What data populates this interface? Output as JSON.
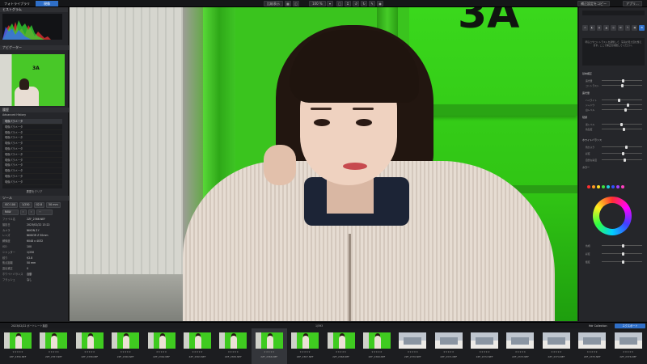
{
  "topbar": {
    "tabs": [
      "フォトライブラリ",
      "現像"
    ],
    "zoom": "100 %",
    "compare_label": "比較表示",
    "right_button": "補正設定をコピー",
    "export_label": "アプリ..."
  },
  "left": {
    "histogram_title": "ヒストグラム",
    "navigator_title": "ナビゲーター",
    "history_title": "履歴",
    "history_header": "Advanced History",
    "history_items": [
      "現像パラメータ",
      "現像パラメータ",
      "現像パラメータ",
      "現像パラメータ",
      "現像パラメータ",
      "現像パラメータ",
      "現像パラメータ",
      "現像パラメータ",
      "現像パラメータ",
      "現像パラメータ",
      "現像パラメータ",
      "現像パラメータ"
    ],
    "history_footer": "履歴をクリア",
    "tool_title": "ツール",
    "tool_buttons_1": [
      "ISO 100",
      "1/250",
      "f/2.8",
      "50 mm"
    ],
    "tool_buttons_2": [
      "RAW",
      "",
      "",
      ""
    ],
    "info": [
      {
        "k": "ファイル名",
        "v": "2ZF_2366.NEF"
      },
      {
        "k": "撮影日",
        "v": "2023/02/22 13:22"
      },
      {
        "k": "カメラ",
        "v": "NIKON Z f"
      },
      {
        "k": "レンズ",
        "v": "NIKKOR Z 50mm"
      },
      {
        "k": "解像度",
        "v": "6048 x 4032"
      },
      {
        "k": "ISO",
        "v": "100"
      },
      {
        "k": "シャッター",
        "v": "1/250"
      },
      {
        "k": "絞り",
        "v": "f/2.8"
      },
      {
        "k": "焦点距離",
        "v": "50 mm"
      },
      {
        "k": "露出補正",
        "v": "0"
      },
      {
        "k": "ホワイトバランス",
        "v": "自動"
      },
      {
        "k": "フラッシュ",
        "v": "なし"
      }
    ],
    "footer": "デバイスデータ",
    "navi_sign": "3A"
  },
  "viewer": {
    "sign_text": "3A"
  },
  "right": {
    "message": "明るさやコントラストを調整して、写真の見た目を整えます。ここで補正を開始してください。",
    "sections": [
      {
        "label": "基本補正",
        "top": 0
      },
      {
        "label": "露光量",
        "top": 0
      },
      {
        "label": "階調",
        "top": 0
      },
      {
        "label": "ホワイトバランス",
        "top": 0
      },
      {
        "label": "カラー",
        "top": 0
      }
    ],
    "sliders": [
      "露光量",
      "コントラスト",
      "ハイライト",
      "シャドウ",
      "白レベル",
      "黒レベル",
      "色温度",
      "色かぶり",
      "彩度",
      "自然な彩度"
    ],
    "wheel_label": "カラーホイール",
    "bottom_sliders": [
      "色相",
      "彩度",
      "輝度"
    ]
  },
  "filmstrip": {
    "title": "2023/02/22 ポートレート撮影",
    "count": "1/593",
    "collection": "Hdr Collection",
    "export": "エクスポート",
    "thumbs": [
      {
        "name": "2ZF_2356.NEF",
        "kind": "green"
      },
      {
        "name": "2ZF_2357.NEF",
        "kind": "green"
      },
      {
        "name": "2ZF_2358.NEF",
        "kind": "green"
      },
      {
        "name": "2ZF_2360.NEF",
        "kind": "green"
      },
      {
        "name": "2ZF_2362.NEF",
        "kind": "green"
      },
      {
        "name": "2ZF_2363.NEF",
        "kind": "green"
      },
      {
        "name": "2ZF_2365.NEF",
        "kind": "green"
      },
      {
        "name": "2ZF_2366.NEF",
        "kind": "green",
        "selected": true
      },
      {
        "name": "2ZF_2367.NEF",
        "kind": "green"
      },
      {
        "name": "2ZF_2368.NEF",
        "kind": "green"
      },
      {
        "name": "2ZF_2369.NEF",
        "kind": "green"
      },
      {
        "name": "2ZF_2370.NEF",
        "kind": "room"
      },
      {
        "name": "2ZF_2371.NEF",
        "kind": "room"
      },
      {
        "name": "2ZF_2372.NEF",
        "kind": "room"
      },
      {
        "name": "2ZF_2373.NEF",
        "kind": "room"
      },
      {
        "name": "2ZF_2374.NEF",
        "kind": "room"
      },
      {
        "name": "2ZF_2375.NEF",
        "kind": "room"
      },
      {
        "name": "2ZF_2376.NEF",
        "kind": "room"
      }
    ]
  },
  "colors": {
    "accent": "#2f6fc8",
    "panel": "#25262a",
    "green": "#3ac41e"
  }
}
